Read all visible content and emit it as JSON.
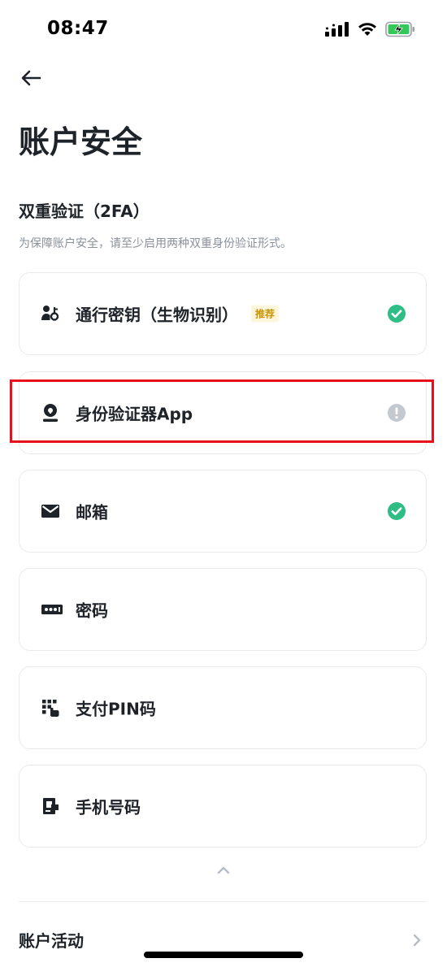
{
  "status_bar": {
    "time": "08:47"
  },
  "header": {
    "title": "账户安全"
  },
  "twofa": {
    "section_title": "双重验证（2FA）",
    "description": "为保障账户安全，请至少启用两种双重身份验证形式。"
  },
  "methods": [
    {
      "label": "通行密钥（生物识别）",
      "badge": "推荐",
      "icon": "passkey-icon",
      "status": "enabled"
    },
    {
      "label": "身份验证器App",
      "icon": "authenticator-icon",
      "status": "warning"
    },
    {
      "label": "邮箱",
      "icon": "email-icon",
      "status": "enabled"
    },
    {
      "label": "密码",
      "icon": "password-icon",
      "status": "none"
    },
    {
      "label": "支付PIN码",
      "icon": "pin-keypad-icon",
      "status": "none"
    },
    {
      "label": "手机号码",
      "icon": "phone-icon",
      "status": "none"
    }
  ],
  "activity": {
    "label": "账户活动"
  },
  "colors": {
    "text_primary": "#1e2329",
    "text_secondary": "#8a919c",
    "success": "#2ebd85",
    "neutral_status": "#c4c8cf",
    "highlight": "#e8111b",
    "badge_text": "#c99400",
    "badge_bg": "#fdf6dc"
  }
}
